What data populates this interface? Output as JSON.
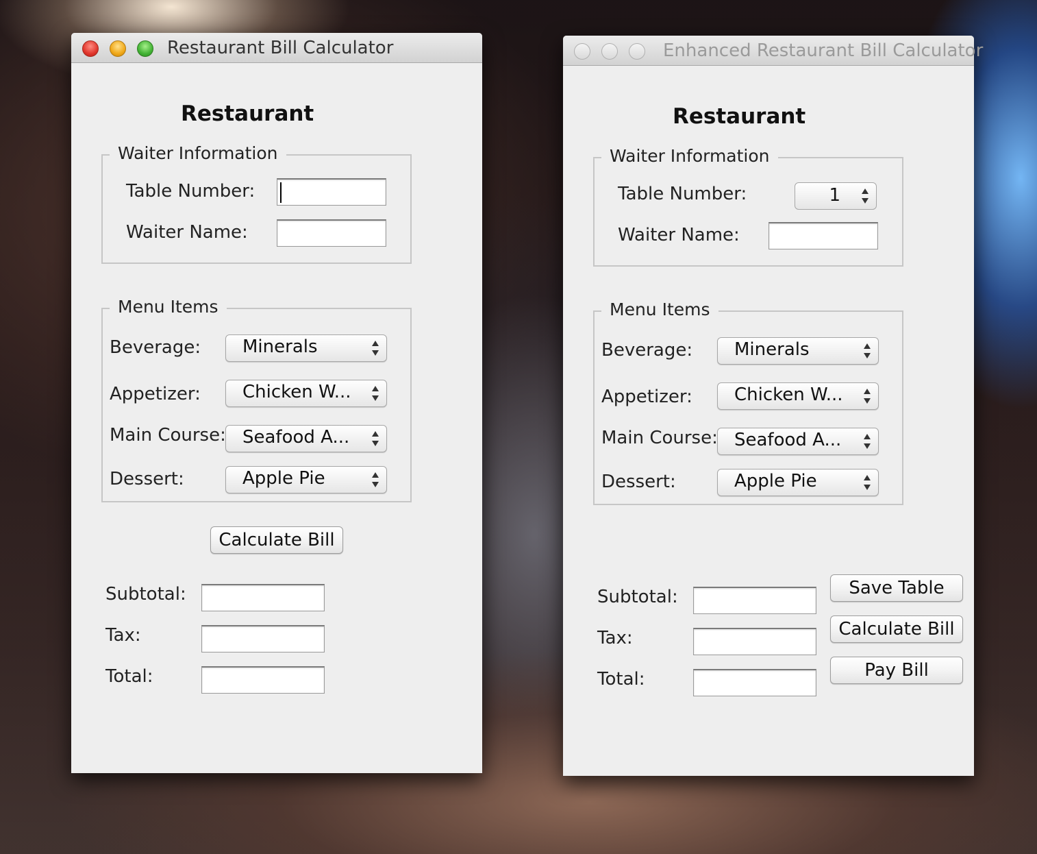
{
  "window1": {
    "title": "Restaurant Bill Calculator",
    "heading": "Restaurant",
    "waiter_group": "Waiter Information",
    "table_number_label": "Table Number:",
    "table_number_value": "",
    "waiter_name_label": "Waiter Name:",
    "waiter_name_value": "",
    "menu_group": "Menu Items",
    "beverage_label": "Beverage:",
    "beverage_value": "Minerals",
    "appetizer_label": "Appetizer:",
    "appetizer_value": "Chicken W...",
    "main_course_label": "Main Course:",
    "main_course_value": "Seafood A...",
    "dessert_label": "Dessert:",
    "dessert_value": "Apple Pie",
    "calculate_button": "Calculate Bill",
    "subtotal_label": "Subtotal:",
    "tax_label": "Tax:",
    "total_label": "Total:"
  },
  "window2": {
    "title": "Enhanced Restaurant Bill Calculator",
    "heading": "Restaurant",
    "waiter_group": "Waiter Information",
    "table_number_label": "Table Number:",
    "table_number_value": "1",
    "waiter_name_label": "Waiter Name:",
    "waiter_name_value": "",
    "menu_group": "Menu Items",
    "beverage_label": "Beverage:",
    "beverage_value": "Minerals",
    "appetizer_label": "Appetizer:",
    "appetizer_value": "Chicken W...",
    "main_course_label": "Main Course:",
    "main_course_value": "Seafood A...",
    "dessert_label": "Dessert:",
    "dessert_value": "Apple Pie",
    "save_button": "Save Table",
    "calculate_button": "Calculate Bill",
    "pay_button": "Pay Bill",
    "subtotal_label": "Subtotal:",
    "tax_label": "Tax:",
    "total_label": "Total:"
  },
  "icons": {
    "close": "close-icon",
    "minimize": "minimize-icon",
    "maximize": "maximize-icon",
    "combo_arrows": "chevron-updown-icon"
  }
}
